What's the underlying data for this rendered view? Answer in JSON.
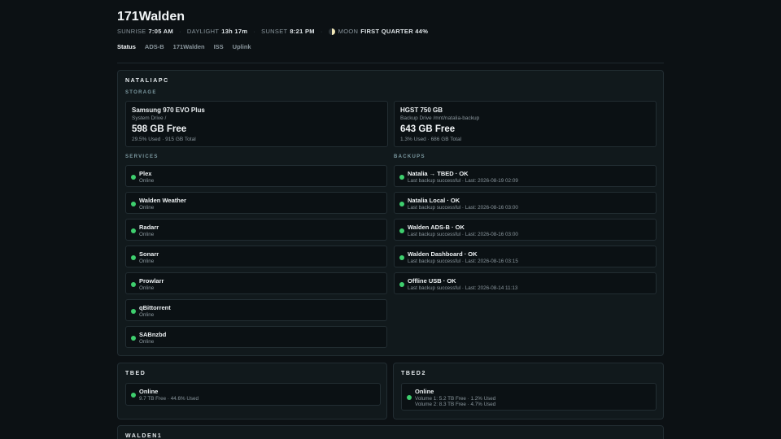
{
  "header": {
    "title": "171Walden",
    "sunrise_label": "SUNRISE",
    "sunrise": "7:05 AM",
    "daylight_label": "DAYLIGHT",
    "daylight": "13h 17m",
    "sunset_label": "SUNSET",
    "sunset": "8:21 PM",
    "moon_label": "MOON",
    "moon": "FIRST QUARTER 44%"
  },
  "nav": [
    "Status",
    "ADS-B",
    "171Walden",
    "ISS",
    "Uplink"
  ],
  "colors": {
    "background": "#0c1114",
    "panel": "#11191c",
    "status_ok": "#3ecf6e",
    "muted": "#8a969d"
  },
  "nataliapc": {
    "title": "NATALIAPC",
    "storage_label": "STORAGE",
    "drives": [
      {
        "name": "Samsung 970 EVO Plus",
        "sub": "System Drive /",
        "free": "598 GB Free",
        "used": "29.5% Used · 915 GB Total"
      },
      {
        "name": "HGST 750 GB",
        "sub": "Backup Drive /mnt/natalia-backup",
        "free": "643 GB Free",
        "used": "1.3% Used · 686 GB Total"
      }
    ],
    "services_label": "SERVICES",
    "services": [
      {
        "name": "Plex",
        "status": "Online"
      },
      {
        "name": "Walden Weather",
        "status": "Online"
      },
      {
        "name": "Radarr",
        "status": "Online"
      },
      {
        "name": "Sonarr",
        "status": "Online"
      },
      {
        "name": "Prowlarr",
        "status": "Online"
      },
      {
        "name": "qBittorrent",
        "status": "Online"
      },
      {
        "name": "SABnzbd",
        "status": "Online"
      }
    ],
    "backups_label": "BACKUPS",
    "backups": [
      {
        "name": "Natalia → TBED · OK",
        "status": "Last backup successful · Last: 2026-08-19 02:09"
      },
      {
        "name": "Natalia Local · OK",
        "status": "Last backup successful · Last: 2026-08-16 03:00"
      },
      {
        "name": "Walden ADS-B · OK",
        "status": "Last backup successful · Last: 2026-08-16 03:00"
      },
      {
        "name": "Walden Dashboard · OK",
        "status": "Last backup successful · Last: 2026-08-16 03:15"
      },
      {
        "name": "Offline USB · OK",
        "status": "Last backup successful · Last: 2026-08-14 11:13"
      }
    ]
  },
  "tbed": {
    "title": "TBED",
    "status": "Online",
    "line1": "9.7 TB Free · 44.6% Used"
  },
  "tbed2": {
    "title": "TBED2",
    "status": "Online",
    "line1": "Volume 1: 5.2 TB Free · 1.2% Used",
    "line2": "Volume 2: 8.3 TB Free · 4.7% Used"
  },
  "walden1": {
    "title": "WALDEN1"
  }
}
